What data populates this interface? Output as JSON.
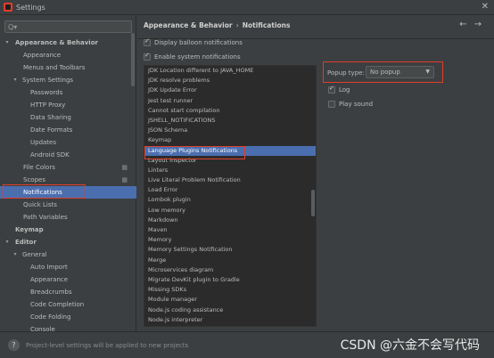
{
  "window": {
    "title": "Settings"
  },
  "search": {
    "placeholder": "Q▾"
  },
  "tree": [
    {
      "label": "Appearance & Behavior",
      "level": 0,
      "arrow": "▾",
      "bold": true
    },
    {
      "label": "Appearance",
      "level": 1
    },
    {
      "label": "Menus and Toolbars",
      "level": 1
    },
    {
      "label": "System Settings",
      "level": 1,
      "arrow": "▾"
    },
    {
      "label": "Passwords",
      "level": 2
    },
    {
      "label": "HTTP Proxy",
      "level": 2
    },
    {
      "label": "Data Sharing",
      "level": 2
    },
    {
      "label": "Date Formats",
      "level": 2
    },
    {
      "label": "Updates",
      "level": 2
    },
    {
      "label": "Android SDK",
      "level": 2
    },
    {
      "label": "File Colors",
      "level": 1,
      "project_icon": true
    },
    {
      "label": "Scopes",
      "level": 1,
      "project_icon": true
    },
    {
      "label": "Notifications",
      "level": 1,
      "selected": true
    },
    {
      "label": "Quick Lists",
      "level": 1
    },
    {
      "label": "Path Variables",
      "level": 1
    },
    {
      "label": "Keymap",
      "level": 0,
      "bold": true
    },
    {
      "label": "Editor",
      "level": 0,
      "arrow": "▾",
      "bold": true
    },
    {
      "label": "General",
      "level": 1,
      "arrow": "▾"
    },
    {
      "label": "Auto Import",
      "level": 2
    },
    {
      "label": "Appearance",
      "level": 2
    },
    {
      "label": "Breadcrumbs",
      "level": 2
    },
    {
      "label": "Code Completion",
      "level": 2
    },
    {
      "label": "Code Folding",
      "level": 2
    },
    {
      "label": "Console",
      "level": 2
    }
  ],
  "breadcrumb": {
    "parent": "Appearance & Behavior",
    "separator": "›",
    "current": "Notifications"
  },
  "nav": {
    "back": "←",
    "forward": "→"
  },
  "options": {
    "display_balloon": "Display balloon notifications",
    "enable_system": "Enable system notifications"
  },
  "notification_groups": [
    "JDK Location different to JAVA_HOME",
    "JDK resolve problems",
    "JDK Update Error",
    "Jest test runner",
    "Cannot start compilation",
    "JSHELL_NOTIFICATIONS",
    "JSON Schema",
    "Keymap",
    "Language Plugins Notifications",
    "Layout Inspector",
    "Linters",
    "Live Literal Problem Notification",
    "Load Error",
    "Lombok plugin",
    "Low memory",
    "Markdown",
    "Maven",
    "Memory",
    "Memory Settings Notification",
    "Merge",
    "Microservices diagram",
    "Migrate DevKit plugin to Gradle",
    "Missing SDKs",
    "Module manager",
    "Node.js coding assistance",
    "Node.js interpreter"
  ],
  "selected_group_index": 8,
  "detail": {
    "popup_type_label": "Popup type:",
    "popup_type_value": "No popup",
    "log_label": "Log",
    "play_sound_label": "Play sound"
  },
  "footer": {
    "help": "?",
    "text": "Project-level settings will be applied to new projects"
  },
  "watermark": "CSDN @六金不会写代码",
  "colors": {
    "selection": "#4b6eaf",
    "highlight_box": "#e03e2d",
    "background": "#3c3f41"
  }
}
